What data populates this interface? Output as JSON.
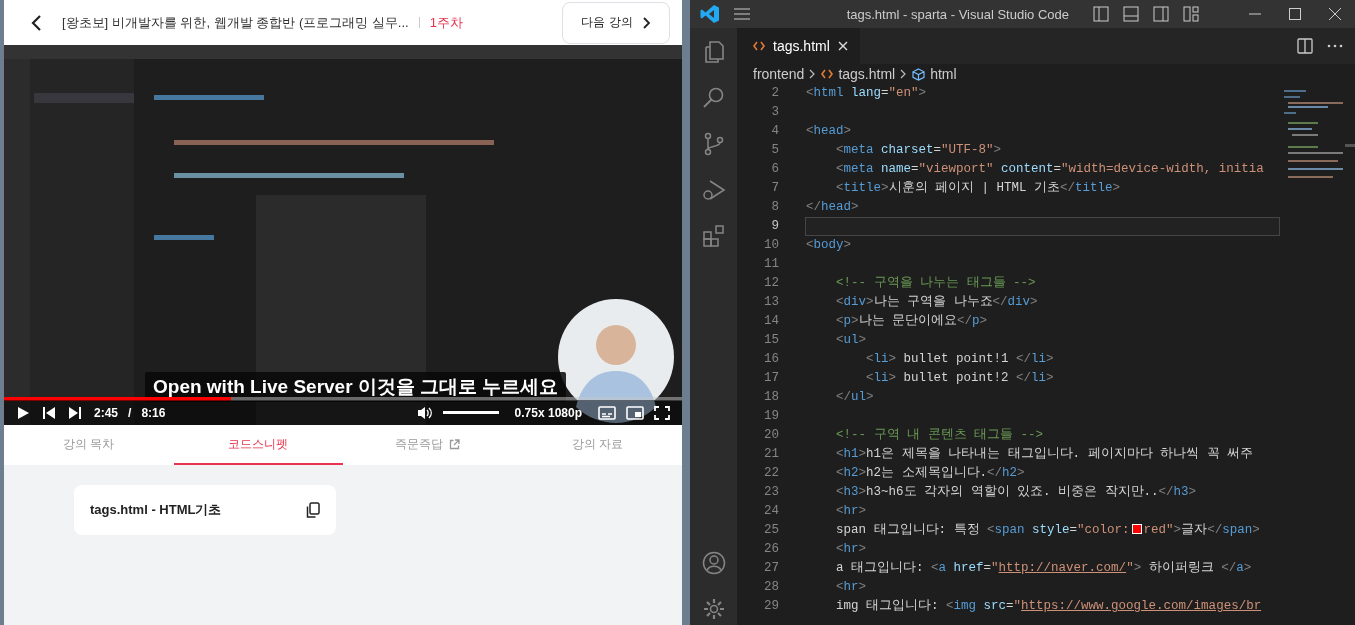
{
  "course_header": {
    "title": "[왕초보] 비개발자를 위한, 웹개발 종합반 (프로그래밍 실무...",
    "week": "1주차",
    "next_button": "다음 강의"
  },
  "video": {
    "caption": "Open with Live Server 이것을 그대로 누르세요",
    "progress": {
      "level": 0.335
    },
    "current_time": "2:45",
    "time_separator": "/",
    "duration": "8:16",
    "volume": {
      "level": 1.0
    },
    "speed_quality": "0.75x 1080p"
  },
  "lesson_tabs": [
    {
      "label": "강의 목차",
      "selected": false,
      "external": false
    },
    {
      "label": "코드스니펫",
      "selected": true,
      "external": false
    },
    {
      "label": "즉문즉답",
      "selected": false,
      "external": true
    },
    {
      "label": "강의 자료",
      "selected": false,
      "external": false
    }
  ],
  "snippets": [
    {
      "label": "tags.html - HTML기초"
    }
  ],
  "editor": {
    "window_title": "tags.html - sparta - Visual Studio Code",
    "tabs": [
      {
        "label": "tags.html",
        "selected": true
      }
    ],
    "breadcrumb": [
      {
        "kind": "folder",
        "label": "frontend"
      },
      {
        "kind": "file",
        "label": "tags.html"
      },
      {
        "kind": "element",
        "label": "html"
      }
    ],
    "lines": [
      {
        "number": "2",
        "current": false,
        "tokens": [
          {
            "kind": "p",
            "text": "<"
          },
          {
            "kind": "tag",
            "text": "html"
          },
          {
            "kind": "attr",
            "text": " lang"
          },
          {
            "kind": "text",
            "text": "="
          },
          {
            "kind": "str",
            "text": "\"en\""
          },
          {
            "kind": "p",
            "text": ">"
          }
        ]
      },
      {
        "number": "3",
        "current": false
      },
      {
        "number": "4",
        "current": false,
        "tokens": [
          {
            "kind": "p",
            "text": "<"
          },
          {
            "kind": "tag",
            "text": "head"
          },
          {
            "kind": "p",
            "text": ">"
          }
        ]
      },
      {
        "number": "5",
        "current": false,
        "tokens": [
          {
            "kind": "p",
            "text": "    <"
          },
          {
            "kind": "tag",
            "text": "meta"
          },
          {
            "kind": "attr",
            "text": " charset"
          },
          {
            "kind": "text",
            "text": "="
          },
          {
            "kind": "str",
            "text": "\"UTF-8\""
          },
          {
            "kind": "p",
            "text": ">"
          }
        ]
      },
      {
        "number": "6",
        "current": false,
        "tokens": [
          {
            "kind": "p",
            "text": "    <"
          },
          {
            "kind": "tag",
            "text": "meta"
          },
          {
            "kind": "attr",
            "text": " name"
          },
          {
            "kind": "text",
            "text": "="
          },
          {
            "kind": "str",
            "text": "\"viewport\""
          },
          {
            "kind": "attr",
            "text": " content"
          },
          {
            "kind": "text",
            "text": "="
          },
          {
            "kind": "str",
            "text": "\"width=device-width, initia"
          }
        ]
      },
      {
        "number": "7",
        "current": false,
        "tokens": [
          {
            "kind": "p",
            "text": "    <"
          },
          {
            "kind": "tag",
            "text": "title"
          },
          {
            "kind": "p",
            "text": ">"
          },
          {
            "kind": "text",
            "text": "시훈의 페이지 | HTML 기초"
          },
          {
            "kind": "p",
            "text": "</"
          },
          {
            "kind": "tag",
            "text": "title"
          },
          {
            "kind": "p",
            "text": ">"
          }
        ]
      },
      {
        "number": "8",
        "current": false,
        "tokens": [
          {
            "kind": "p",
            "text": "</"
          },
          {
            "kind": "tag",
            "text": "head"
          },
          {
            "kind": "p",
            "text": ">"
          }
        ]
      },
      {
        "number": "9",
        "current": true
      },
      {
        "number": "10",
        "current": false,
        "tokens": [
          {
            "kind": "p",
            "text": "<"
          },
          {
            "kind": "tag",
            "text": "body"
          },
          {
            "kind": "p",
            "text": ">"
          }
        ]
      },
      {
        "number": "11",
        "current": false
      },
      {
        "number": "12",
        "current": false,
        "tokens": [
          {
            "kind": "cmt",
            "text": "    <!-- 구역을 나누는 태그들 -->"
          }
        ]
      },
      {
        "number": "13",
        "current": false,
        "tokens": [
          {
            "kind": "p",
            "text": "    <"
          },
          {
            "kind": "tag",
            "text": "div"
          },
          {
            "kind": "p",
            "text": ">"
          },
          {
            "kind": "text",
            "text": "나는 구역을 나누죠"
          },
          {
            "kind": "p",
            "text": "</"
          },
          {
            "kind": "tag",
            "text": "div"
          },
          {
            "kind": "p",
            "text": ">"
          }
        ]
      },
      {
        "number": "14",
        "current": false,
        "tokens": [
          {
            "kind": "p",
            "text": "    <"
          },
          {
            "kind": "tag",
            "text": "p"
          },
          {
            "kind": "p",
            "text": ">"
          },
          {
            "kind": "text",
            "text": "나는 문단이에요"
          },
          {
            "kind": "p",
            "text": "</"
          },
          {
            "kind": "tag",
            "text": "p"
          },
          {
            "kind": "p",
            "text": ">"
          }
        ]
      },
      {
        "number": "15",
        "current": false,
        "tokens": [
          {
            "kind": "p",
            "text": "    <"
          },
          {
            "kind": "tag",
            "text": "ul"
          },
          {
            "kind": "p",
            "text": ">"
          }
        ]
      },
      {
        "number": "16",
        "current": false,
        "tokens": [
          {
            "kind": "p",
            "text": "        <"
          },
          {
            "kind": "tag",
            "text": "li"
          },
          {
            "kind": "p",
            "text": ">"
          },
          {
            "kind": "text",
            "text": " bullet point!1 "
          },
          {
            "kind": "p",
            "text": "</"
          },
          {
            "kind": "tag",
            "text": "li"
          },
          {
            "kind": "p",
            "text": ">"
          }
        ]
      },
      {
        "number": "17",
        "current": false,
        "tokens": [
          {
            "kind": "p",
            "text": "        <"
          },
          {
            "kind": "tag",
            "text": "li"
          },
          {
            "kind": "p",
            "text": ">"
          },
          {
            "kind": "text",
            "text": " bullet point!2 "
          },
          {
            "kind": "p",
            "text": "</"
          },
          {
            "kind": "tag",
            "text": "li"
          },
          {
            "kind": "p",
            "text": ">"
          }
        ]
      },
      {
        "number": "18",
        "current": false,
        "tokens": [
          {
            "kind": "p",
            "text": "    </"
          },
          {
            "kind": "tag",
            "text": "ul"
          },
          {
            "kind": "p",
            "text": ">"
          }
        ]
      },
      {
        "number": "19",
        "current": false
      },
      {
        "number": "20",
        "current": false,
        "tokens": [
          {
            "kind": "cmt",
            "text": "    <!-- 구역 내 콘텐츠 태그들 -->"
          }
        ]
      },
      {
        "number": "21",
        "current": false,
        "tokens": [
          {
            "kind": "p",
            "text": "    <"
          },
          {
            "kind": "tag",
            "text": "h1"
          },
          {
            "kind": "p",
            "text": ">"
          },
          {
            "kind": "text",
            "text": "h1은 제목을 나타내는 태그입니다. 페이지마다 하나씩 꼭 써주"
          }
        ]
      },
      {
        "number": "22",
        "current": false,
        "tokens": [
          {
            "kind": "p",
            "text": "    <"
          },
          {
            "kind": "tag",
            "text": "h2"
          },
          {
            "kind": "p",
            "text": ">"
          },
          {
            "kind": "text",
            "text": "h2는 소제목입니다."
          },
          {
            "kind": "p",
            "text": "</"
          },
          {
            "kind": "tag",
            "text": "h2"
          },
          {
            "kind": "p",
            "text": ">"
          }
        ]
      },
      {
        "number": "23",
        "current": false,
        "tokens": [
          {
            "kind": "p",
            "text": "    <"
          },
          {
            "kind": "tag",
            "text": "h3"
          },
          {
            "kind": "p",
            "text": ">"
          },
          {
            "kind": "text",
            "text": "h3~h6도 각자의 역할이 있죠. 비중은 작지만.."
          },
          {
            "kind": "p",
            "text": "</"
          },
          {
            "kind": "tag",
            "text": "h3"
          },
          {
            "kind": "p",
            "text": ">"
          }
        ]
      },
      {
        "number": "24",
        "current": false,
        "tokens": [
          {
            "kind": "p",
            "text": "    <"
          },
          {
            "kind": "tag",
            "text": "hr"
          },
          {
            "kind": "p",
            "text": ">"
          }
        ]
      },
      {
        "number": "25",
        "current": false,
        "tokens": [
          {
            "kind": "text",
            "text": "    span 태그입니다: 특정 "
          },
          {
            "kind": "p",
            "text": "<"
          },
          {
            "kind": "tag",
            "text": "span"
          },
          {
            "kind": "attr",
            "text": " style"
          },
          {
            "kind": "text",
            "text": "="
          },
          {
            "kind": "str",
            "text": "\"color:"
          },
          {
            "kind": "swatch"
          },
          {
            "kind": "str",
            "text": "red\""
          },
          {
            "kind": "p",
            "text": ">"
          },
          {
            "kind": "text",
            "text": "글자"
          },
          {
            "kind": "p",
            "text": "</"
          },
          {
            "kind": "tag",
            "text": "span"
          },
          {
            "kind": "p",
            "text": ">"
          }
        ]
      },
      {
        "number": "26",
        "current": false,
        "tokens": [
          {
            "kind": "p",
            "text": "    <"
          },
          {
            "kind": "tag",
            "text": "hr"
          },
          {
            "kind": "p",
            "text": ">"
          }
        ]
      },
      {
        "number": "27",
        "current": false,
        "tokens": [
          {
            "kind": "text",
            "text": "    a 태그입니다: "
          },
          {
            "kind": "p",
            "text": "<"
          },
          {
            "kind": "tag",
            "text": "a"
          },
          {
            "kind": "attr",
            "text": " href"
          },
          {
            "kind": "text",
            "text": "="
          },
          {
            "kind": "str",
            "text": "\""
          },
          {
            "kind": "link",
            "text": "http://naver.com/"
          },
          {
            "kind": "str",
            "text": "\""
          },
          {
            "kind": "p",
            "text": ">"
          },
          {
            "kind": "text",
            "text": " 하이퍼링크 "
          },
          {
            "kind": "p",
            "text": "</"
          },
          {
            "kind": "tag",
            "text": "a"
          },
          {
            "kind": "p",
            "text": ">"
          }
        ]
      },
      {
        "number": "28",
        "current": false,
        "tokens": [
          {
            "kind": "p",
            "text": "    <"
          },
          {
            "kind": "tag",
            "text": "hr"
          },
          {
            "kind": "p",
            "text": ">"
          }
        ]
      },
      {
        "number": "29",
        "current": false,
        "tokens": [
          {
            "kind": "text",
            "text": "    img 태그입니다: "
          },
          {
            "kind": "p",
            "text": "<"
          },
          {
            "kind": "tag",
            "text": "img"
          },
          {
            "kind": "attr",
            "text": " src"
          },
          {
            "kind": "text",
            "text": "="
          },
          {
            "kind": "str",
            "text": "\""
          },
          {
            "kind": "link",
            "text": "https://www.google.com/images/br"
          }
        ]
      }
    ]
  }
}
